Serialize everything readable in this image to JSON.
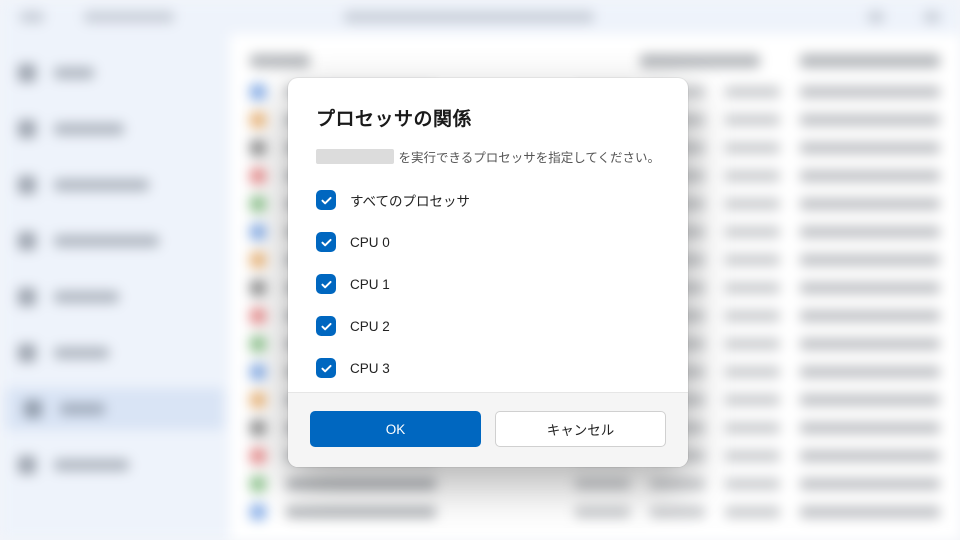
{
  "colors": {
    "accent": "#0067c0"
  },
  "dialog": {
    "title": "プロセッサの関係",
    "description_suffix": "を実行できるプロセッサを指定してください。",
    "options": [
      {
        "label": "すべてのプロセッサ",
        "checked": true
      },
      {
        "label": "CPU 0",
        "checked": true
      },
      {
        "label": "CPU 1",
        "checked": true
      },
      {
        "label": "CPU 2",
        "checked": true
      },
      {
        "label": "CPU 3",
        "checked": true
      }
    ],
    "primary_button": "OK",
    "secondary_button": "キャンセル"
  }
}
